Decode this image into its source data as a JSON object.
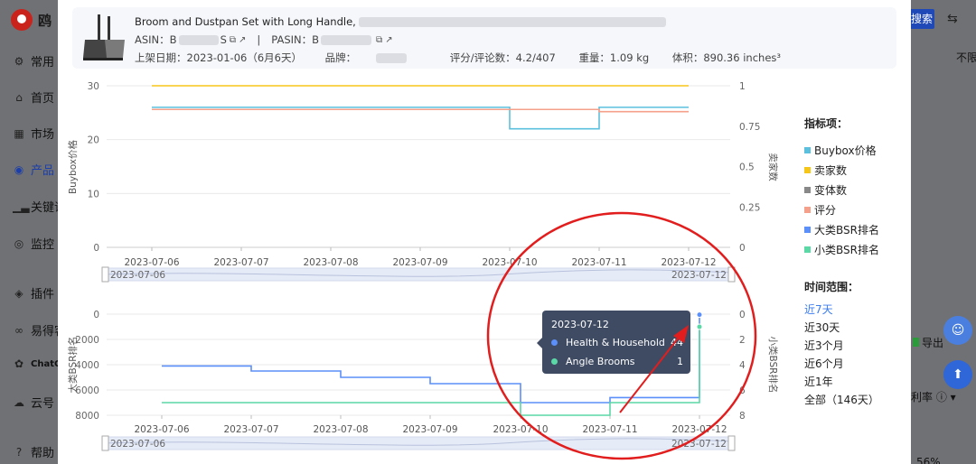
{
  "sidebar": {
    "logo_text": "鸥",
    "items": [
      {
        "label": "常用",
        "icon": "gear-icon"
      },
      {
        "label": "首页",
        "icon": "home-icon"
      },
      {
        "label": "市场",
        "icon": "grid-icon"
      },
      {
        "label": "产品",
        "icon": "target-icon"
      },
      {
        "label": "关键词",
        "icon": "bar-chart-icon"
      },
      {
        "label": "监控",
        "icon": "monitor-icon"
      },
      {
        "label": "插件",
        "icon": "plugin-icon"
      },
      {
        "label": "易得客",
        "icon": "link-icon"
      },
      {
        "label": "ChatGP",
        "icon": "chatgpt-icon"
      },
      {
        "label": "云号",
        "icon": "cloud-icon"
      },
      {
        "label": "帮助",
        "icon": "help-icon"
      }
    ]
  },
  "right_background": {
    "button_label": "搜索",
    "separator": "不限",
    "export_label": "导出",
    "profit_label": "利率",
    "percent": "56%"
  },
  "product": {
    "title": "Broom and Dustpan Set with Long Handle,",
    "asin_label": "ASIN：",
    "asin_prefix": "B",
    "asin_suffix": "S",
    "separator": "|",
    "pasin_label": "PASIN：",
    "pasin_prefix": "B",
    "listing_date": "上架日期：2023-01-06（6月6天）",
    "brand_label": "品牌：",
    "rating": "评分/评论数：4.2/407",
    "weight": "重量：1.09 kg",
    "volume": "体积：890.36 inches³"
  },
  "legend": {
    "title": "指标项：",
    "items": [
      {
        "label": "Buybox价格",
        "color": "#5bc0de"
      },
      {
        "label": "卖家数",
        "color": "#f5c518"
      },
      {
        "label": "变体数",
        "color": "#888888"
      },
      {
        "label": "评分",
        "color": "#f4a08a"
      },
      {
        "label": "大类BSR排名",
        "color": "#5b8ff9"
      },
      {
        "label": "小类BSR排名",
        "color": "#5ad8a6"
      }
    ]
  },
  "time_range": {
    "title": "时间范围：",
    "options": [
      "近7天",
      "近30天",
      "近3个月",
      "近6个月",
      "近1年",
      "全部（146天）"
    ],
    "selected": "近7天"
  },
  "tooltip": {
    "date": "2023-07-12",
    "rows": [
      {
        "name": "Health & Household",
        "value": "44",
        "color": "#5b8ff9"
      },
      {
        "name": "Angle Brooms",
        "value": "1",
        "color": "#5ad8a6"
      }
    ]
  },
  "chart_data": [
    {
      "type": "line",
      "x": [
        "2023-07-06",
        "2023-07-07",
        "2023-07-08",
        "2023-07-09",
        "2023-07-10",
        "2023-07-11",
        "2023-07-12"
      ],
      "ylabel": "Buybox价格",
      "y2label": "卖家数",
      "ylim": [
        0,
        30
      ],
      "y2lim": [
        0,
        1
      ],
      "yticks": [
        "0",
        "10",
        "20",
        "30"
      ],
      "y2ticks": [
        "0",
        "0.25",
        "0.5",
        "0.75",
        "1"
      ],
      "slider_start": "2023-07-06",
      "slider_end": "2023-07-12",
      "series": [
        {
          "name": "Buybox价格",
          "color": "#5bc0de",
          "values": [
            26,
            26,
            26,
            26,
            22,
            26,
            26
          ]
        },
        {
          "name": "卖家数",
          "axis": "right",
          "color": "#f5c518",
          "values": [
            1,
            1,
            1,
            1,
            1,
            1,
            1
          ]
        },
        {
          "name": "评分",
          "color": "#f4a08a",
          "values": [
            25.6,
            25.6,
            25.6,
            25.6,
            25.6,
            25.2,
            25.2
          ]
        }
      ]
    },
    {
      "type": "line",
      "x": [
        "2023-07-06",
        "2023-07-07",
        "2023-07-08",
        "2023-07-09",
        "2023-07-10",
        "2023-07-11",
        "2023-07-12"
      ],
      "ylabel": "大类BSR排名",
      "y2label": "小类BSR排名",
      "ylim": [
        8000,
        0
      ],
      "y2lim": [
        8,
        0
      ],
      "yticks": [
        "0",
        "2000",
        "4000",
        "6000",
        "8000"
      ],
      "y2ticks": [
        "0",
        "2",
        "4",
        "6",
        "8"
      ],
      "slider_start": "2023-07-06",
      "slider_end": "2023-07-12",
      "series": [
        {
          "name": "大类BSR排名",
          "color": "#5b8ff9",
          "values": [
            4100,
            4500,
            5000,
            5500,
            7000,
            6600,
            44
          ]
        },
        {
          "name": "小类BSR排名",
          "axis": "right",
          "color": "#5ad8a6",
          "values": [
            7,
            7,
            7,
            7,
            8,
            7,
            1
          ]
        }
      ]
    }
  ]
}
